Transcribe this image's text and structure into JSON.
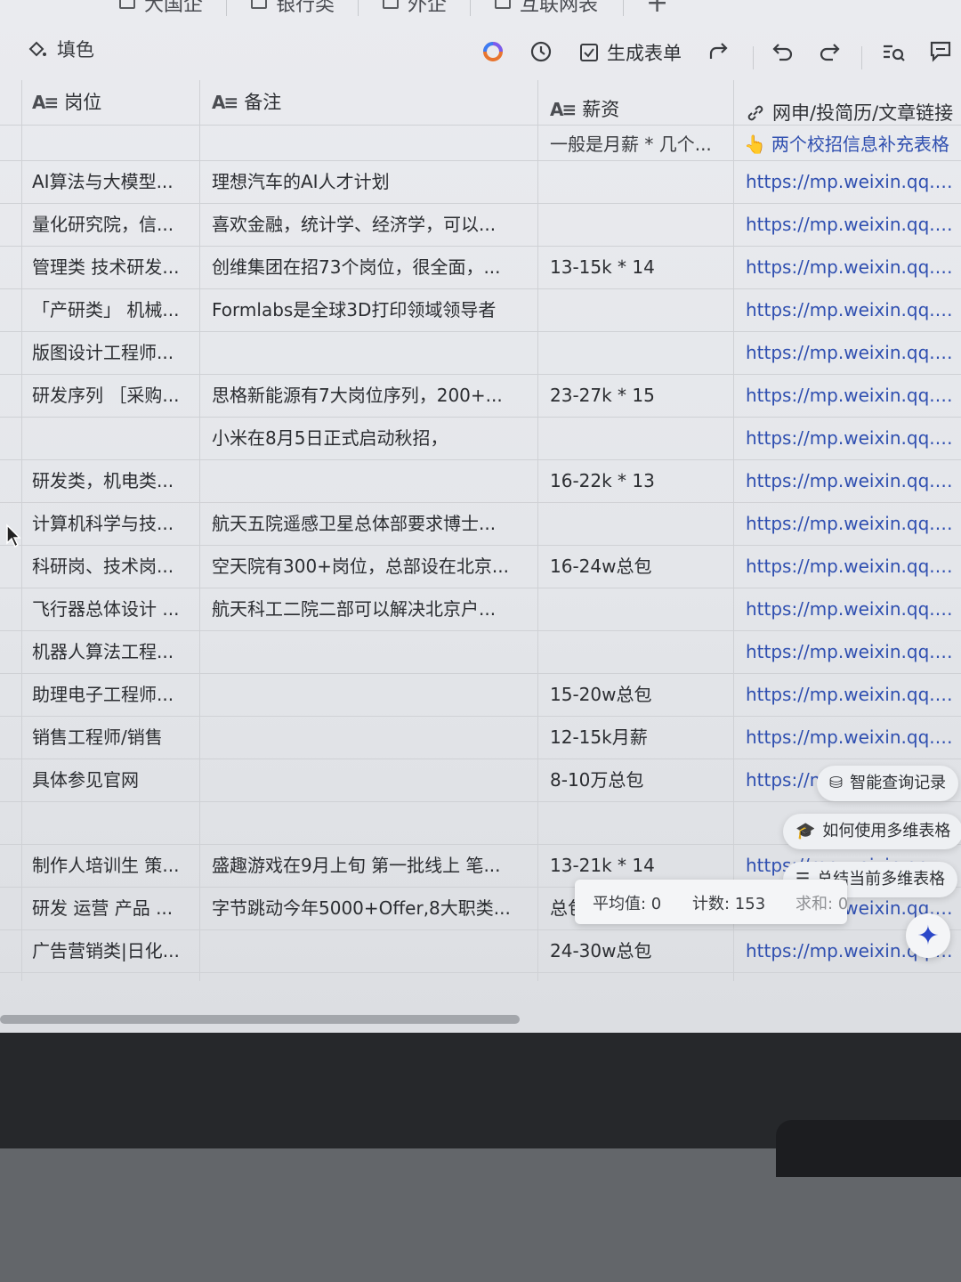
{
  "view_tabs": [
    "大国企",
    "银行类",
    "外企",
    "互联网表"
  ],
  "toolbar": {
    "fill_label": "填色",
    "generate_form_label": "生成表单"
  },
  "columns": [
    {
      "title": "岗位",
      "type_icon": "text-field-icon"
    },
    {
      "title": "备注",
      "type_icon": "text-field-icon"
    },
    {
      "title": "薪资",
      "type_icon": "text-field-icon"
    },
    {
      "title": "网申/投简历/文章链接",
      "type_icon": "link-icon"
    }
  ],
  "subheader": {
    "salary": "一般是月薪 * 几个...",
    "link": "两个校招信息补充表格"
  },
  "rows": [
    {
      "pos": "AI算法与大模型...",
      "note": "理想汽车的AI人才计划",
      "salary": "",
      "link": "https://mp.weixin.qq.co..."
    },
    {
      "pos": "量化研究院，信...",
      "note": "喜欢金融，统计学、经济学，可以...",
      "salary": "",
      "link": "https://mp.weixin.qq.co..."
    },
    {
      "pos": "管理类 技术研发...",
      "note": "创维集团在招73个岗位，很全面，...",
      "salary": "13-15k * 14",
      "link": "https://mp.weixin.qq.co..."
    },
    {
      "pos": "「产研类」 机械...",
      "note": "Formlabs是全球3D打印领域领导者",
      "salary": "",
      "link": "https://mp.weixin.qq.co..."
    },
    {
      "pos": "版图设计工程师...",
      "note": "",
      "salary": "",
      "link": "https://mp.weixin.qq.co..."
    },
    {
      "pos": "研发序列 ［采购...",
      "note": "思格新能源有7大岗位序列，200+...",
      "salary": "23-27k * 15",
      "link": "https://mp.weixin.qq.co..."
    },
    {
      "pos": "",
      "note": "小米在8月5日正式启动秋招，",
      "salary": "",
      "link": "https://mp.weixin.qq.co..."
    },
    {
      "pos": "研发类，机电类...",
      "note": "",
      "salary": "16-22k * 13",
      "link": "https://mp.weixin.qq.co..."
    },
    {
      "pos": "计算机科学与技...",
      "note": "航天五院遥感卫星总体部要求博士...",
      "salary": "",
      "link": "https://mp.weixin.qq.co..."
    },
    {
      "pos": "科研岗、技术岗...",
      "note": "空天院有300+岗位，总部设在北京...",
      "salary": "16-24w总包",
      "link": "https://mp.weixin.qq.co..."
    },
    {
      "pos": "飞行器总体设计 ...",
      "note": "航天科工二院二部可以解决北京户...",
      "salary": "",
      "link": "https://mp.weixin.qq.co..."
    },
    {
      "pos": "机器人算法工程...",
      "note": "",
      "salary": "",
      "link": "https://mp.weixin.qq.co..."
    },
    {
      "pos": "助理电子工程师...",
      "note": "",
      "salary": "15-20w总包",
      "link": "https://mp.weixin.qq.co..."
    },
    {
      "pos": "销售工程师/销售",
      "note": "",
      "salary": "12-15k月薪",
      "link": "https://mp.weixin.qq.co..."
    },
    {
      "pos": "具体参见官网",
      "note": "",
      "salary": "8-10万总包",
      "link": "https://mp.weixin.qq.co..."
    },
    {
      "pos": "",
      "note": "",
      "salary": "",
      "link": ""
    },
    {
      "pos": "制作人培训生 策...",
      "note": "盛趣游戏在9月上旬 第一批线上 笔...",
      "salary": "13-21k * 14",
      "link": "https://mp.weixin.qq.co..."
    },
    {
      "pos": "研发 运营 产品 ...",
      "note": "字节跳动今年5000+Offer,8大职类...",
      "salary": "总包",
      "link": "https://mp.weixin.qq.co..."
    },
    {
      "pos": "广告营销类|日化...",
      "note": "",
      "salary": "24-30w总包",
      "link": "https://mp.weixin.qq.co..."
    }
  ],
  "ai_pills": {
    "smart_query": "智能查询记录",
    "how_to_use": "如何使用多维表格",
    "summarize": "总结当前多维表格"
  },
  "stats": {
    "avg": "平均值: 0",
    "count": "计数: 153",
    "sum": "求和: 0"
  },
  "colors": {
    "link": "#2f4fb0",
    "accent_spark": "#2b47c8"
  }
}
